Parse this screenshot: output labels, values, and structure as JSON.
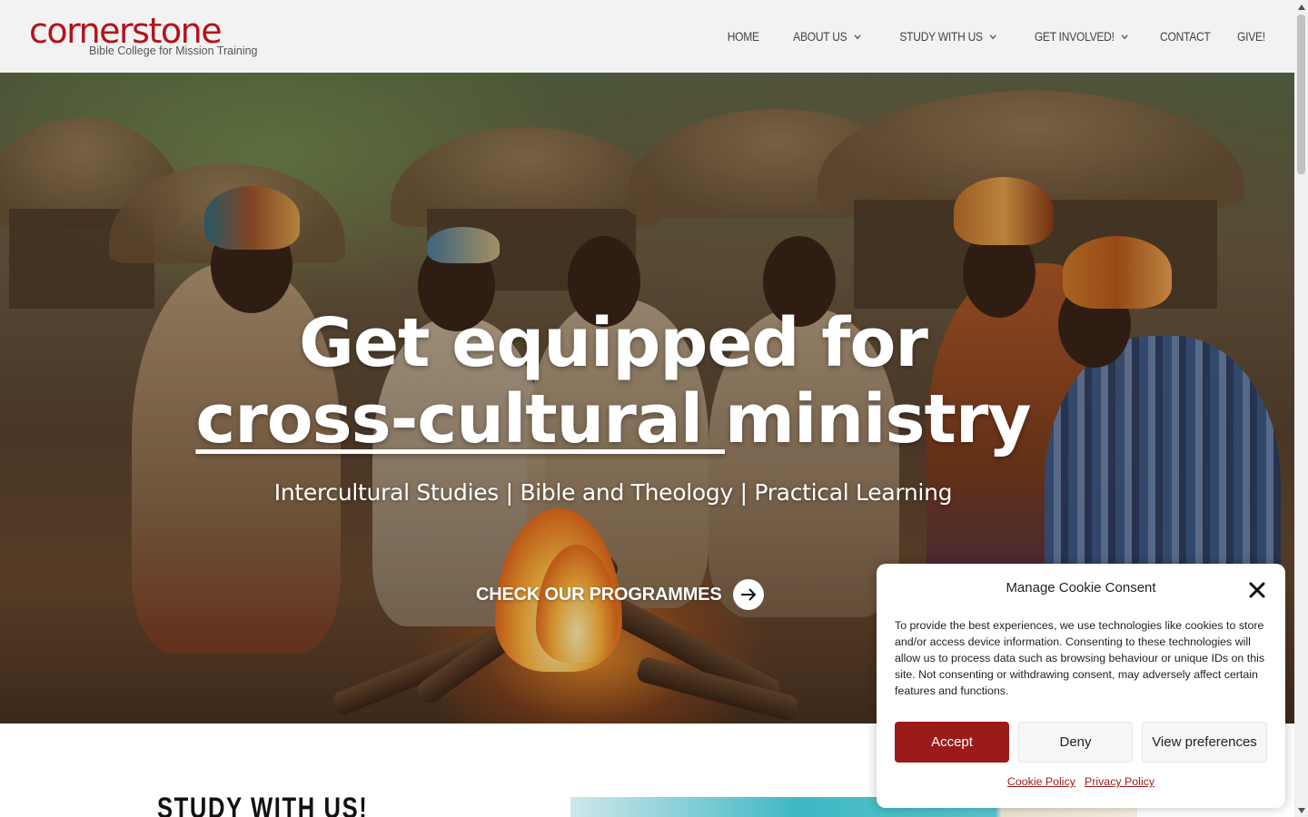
{
  "header": {
    "logo": {
      "wordmark": "cornerstone",
      "tagline": "Bible College for Mission Training"
    },
    "nav": [
      {
        "label": "HOME",
        "has_dropdown": false
      },
      {
        "label": "ABOUT US",
        "has_dropdown": true
      },
      {
        "label": "STUDY WITH US",
        "has_dropdown": true
      },
      {
        "label": "GET INVOLVED!",
        "has_dropdown": true
      },
      {
        "label": "CONTACT",
        "has_dropdown": false
      },
      {
        "label": "GIVE!",
        "has_dropdown": false
      }
    ]
  },
  "hero": {
    "title_line1": "Get equipped for",
    "title_line2_underlined": "cross-cultural ",
    "title_line2_rest": "ministry",
    "subtitle": "Intercultural Studies | Bible and Theology | Practical Learning",
    "cta_label": "CHECK OUR PROGRAMMES",
    "cta_icon": "arrow-right-icon"
  },
  "study_section": {
    "heading": "STUDY WITH US!"
  },
  "cookie_modal": {
    "title": "Manage Cookie Consent",
    "close_icon": "close-icon",
    "text": "To provide the best experiences, we use technologies like cookies to store and/or access device information. Consenting to these technologies will allow us to process data such as browsing behaviour or unique IDs on this site. Not consenting or withdrawing consent, may adversely affect certain features and functions.",
    "buttons": {
      "accept": "Accept",
      "deny": "Deny",
      "preferences": "View preferences"
    },
    "links": {
      "cookie_policy": "Cookie Policy",
      "privacy_policy": "Privacy Policy"
    }
  },
  "colors": {
    "brand_red": "#b5121b",
    "accept_button": "#9b1b1b",
    "header_bg": "#f2f2f2"
  }
}
